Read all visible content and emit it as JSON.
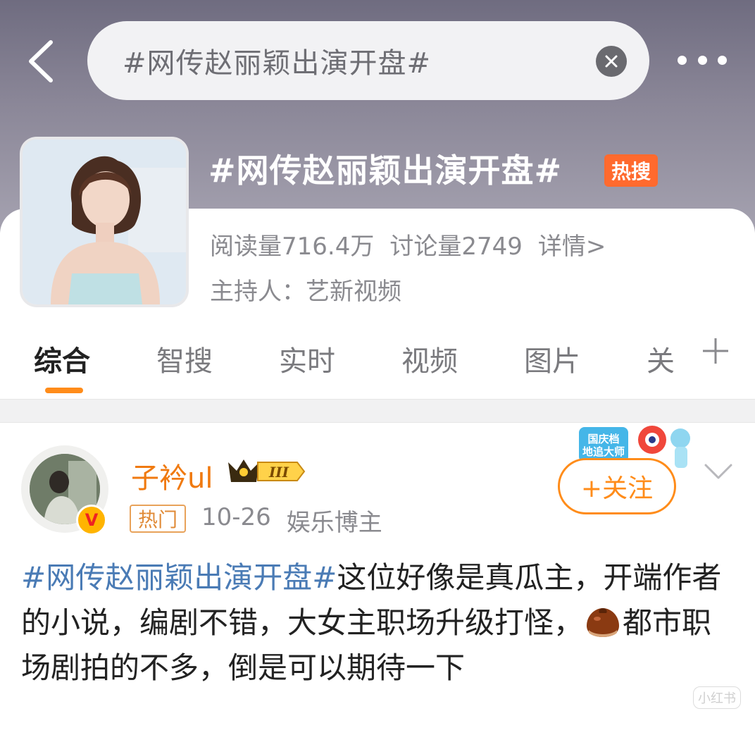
{
  "search": {
    "query": "#网传赵丽颖出演开盘#"
  },
  "topic": {
    "title": "#网传赵丽颖出演开盘#",
    "badge": "热搜",
    "reads": "阅读量716.4万",
    "discussions": "讨论量2749",
    "details": "详情>",
    "host": "主持人：艺新视频"
  },
  "tabs": [
    {
      "label": "综合"
    },
    {
      "label": "智搜"
    },
    {
      "label": "实时"
    },
    {
      "label": "视频"
    },
    {
      "label": "图片"
    },
    {
      "label": "关"
    }
  ],
  "post": {
    "username": "子衿ul",
    "vip_level": "III",
    "hot_tag": "热门",
    "date": "10-26",
    "role": "娱乐博主",
    "follow_label": "+关注",
    "sticker_text": "国庆档 地追大师",
    "hashtag": "#网传赵丽颖出演开盘#",
    "text_1": "这位好像是真瓜主，开端作者的小说，编剧不错，大女主职场升级打怪，",
    "text_2": "都市职场剧拍的不多，倒是可以期待一下",
    "verify": "V"
  },
  "watermark": "小红书",
  "colors": {
    "accent": "#ff8c1a",
    "hashtag": "#4a7bb5",
    "hot": "#ff6a2e",
    "username": "#f07a10"
  },
  "icons": [
    "back-arrow-icon",
    "clear-icon",
    "more-icon",
    "plus-icon",
    "chevron-down-icon",
    "chestnut-emoji-icon"
  ]
}
